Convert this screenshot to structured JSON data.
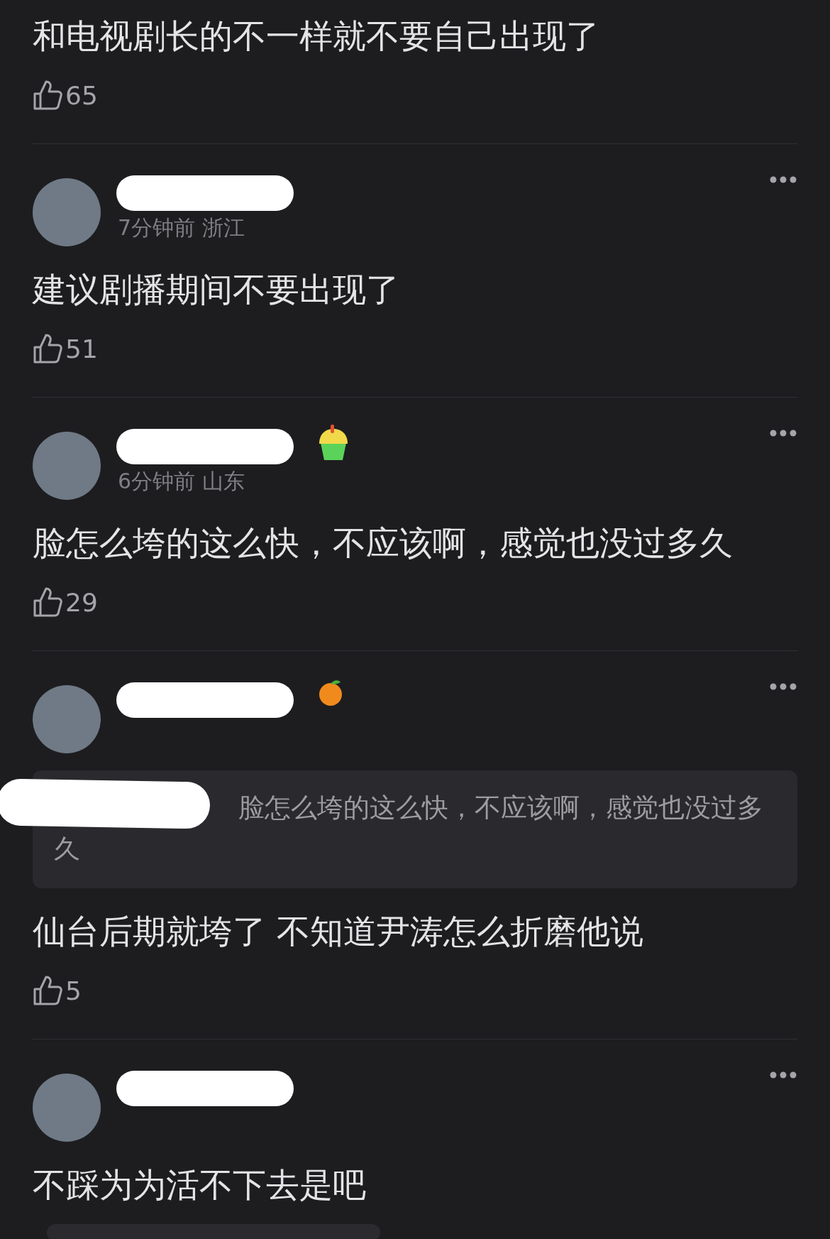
{
  "comments": [
    {
      "text": "和电视剧长的不一样就不要自己出现了",
      "likes": "65"
    },
    {
      "header": {
        "redacted": true,
        "meta": "7分钟前 浙江"
      },
      "text": "建议剧播期间不要出现了",
      "likes": "51"
    },
    {
      "header": {
        "redacted": true,
        "meta": "6分钟前 山东",
        "badge": {
          "kind": "cupcake"
        }
      },
      "text": "脸怎么垮的这么快，不应该啊，感觉也没过多久",
      "likes": "29"
    },
    {
      "header": {
        "redacted": true,
        "badge": {
          "kind": "orange"
        }
      },
      "quote": {
        "redacted": true,
        "text": "脸怎么垮的这么快，不应该啊，感觉也没过多久"
      },
      "text": "仙台后期就垮了 不知道尹涛怎么折磨他说",
      "likes": "5"
    },
    {
      "header": {
        "redacted": true
      },
      "text": "不踩为为活不下去是吧"
    }
  ]
}
